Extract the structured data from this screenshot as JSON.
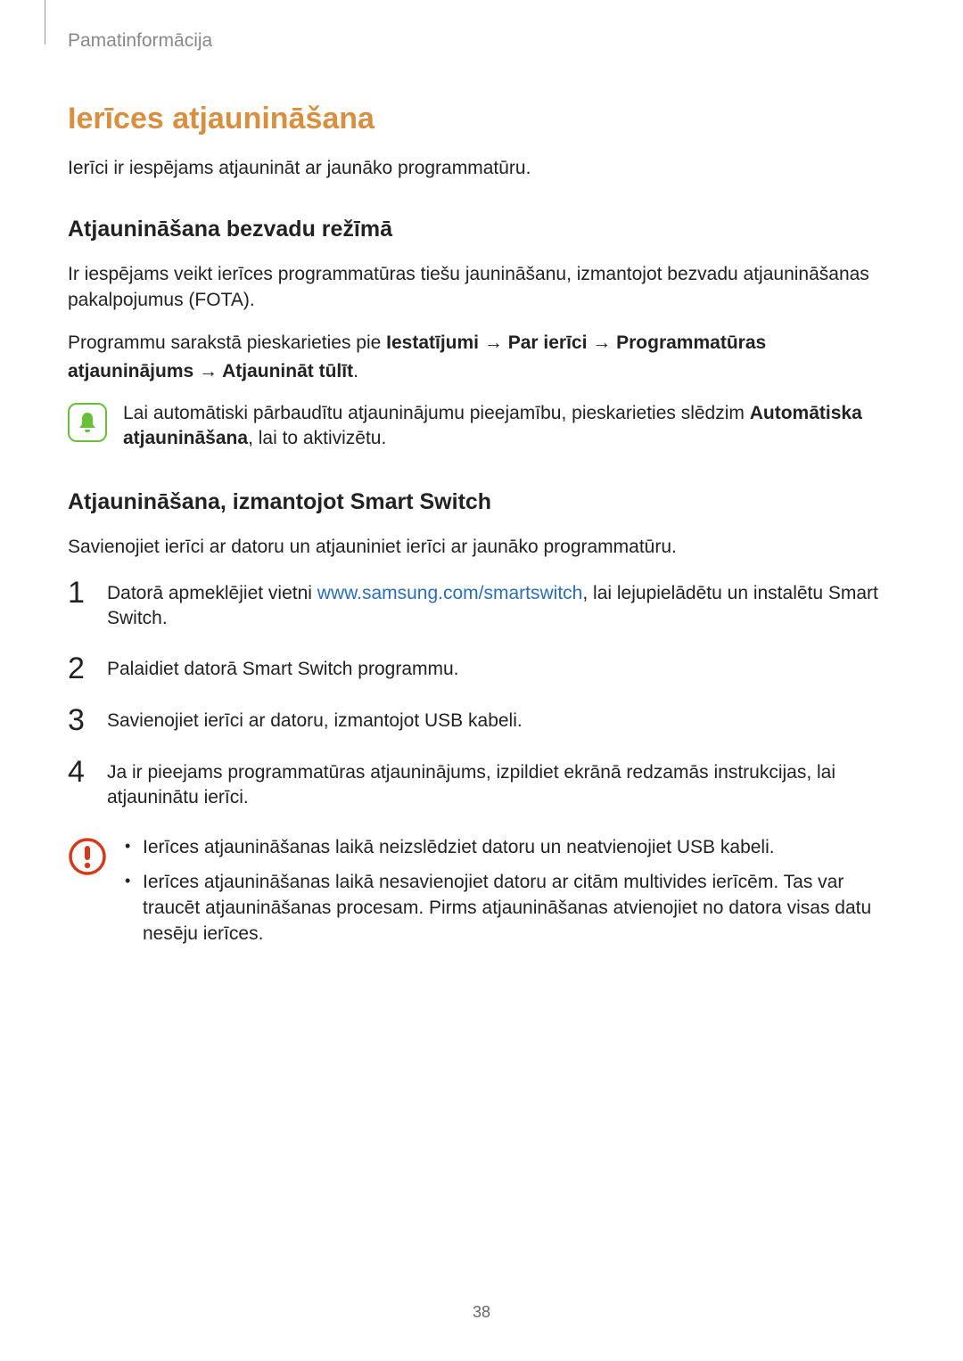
{
  "chapter": "Pamatinformācija",
  "h1": "Ierīces atjaunināšana",
  "intro": "Ierīci ir iespējams atjaunināt ar jaunāko programmatūru.",
  "section1": {
    "heading": "Atjaunināšana bezvadu režīmā",
    "p1": "Ir iespējams veikt ierīces programmatūras tiešu jaunināšanu, izmantojot bezvadu atjaunināšanas pakalpojumus (FOTA).",
    "nav_prefix": "Programmu sarakstā pieskarieties pie ",
    "nav_b1": "Iestatījumi",
    "nav_arrow": " → ",
    "nav_b2": "Par ierīci",
    "nav_b3": "Programmatūras atjauninājums",
    "nav_b4": "Atjaunināt tūlīt",
    "nav_end": ".",
    "note_pre": "Lai automātiski pārbaudītu atjauninājumu pieejamību, pieskarieties slēdzim ",
    "note_bold": "Automātiska atjaunināšana",
    "note_post": ", lai to aktivizētu."
  },
  "section2": {
    "heading": "Atjaunināšana, izmantojot Smart Switch",
    "p1": "Savienojiet ierīci ar datoru un atjauniniet ierīci ar jaunāko programmatūru.",
    "steps": {
      "s1_pre": "Datorā apmeklējiet vietni ",
      "s1_link": "www.samsung.com/smartswitch",
      "s1_post": ", lai lejupielādētu un instalētu Smart Switch.",
      "s2": "Palaidiet datorā Smart Switch programmu.",
      "s3": "Savienojiet ierīci ar datoru, izmantojot USB kabeli.",
      "s4": "Ja ir pieejams programmatūras atjauninājums, izpildiet ekrānā redzamās instrukcijas, lai atjauninātu ierīci."
    },
    "warnings": {
      "w1": "Ierīces atjaunināšanas laikā neizslēdziet datoru un neatvienojiet USB kabeli.",
      "w2": "Ierīces atjaunināšanas laikā nesavienojiet datoru ar citām multivides ierīcēm. Tas var traucēt atjaunināšanas procesam. Pirms atjaunināšanas atvienojiet no datora visas datu nesēju ierīces."
    }
  },
  "page_number": "38",
  "numbers": {
    "n1": "1",
    "n2": "2",
    "n3": "3",
    "n4": "4"
  }
}
